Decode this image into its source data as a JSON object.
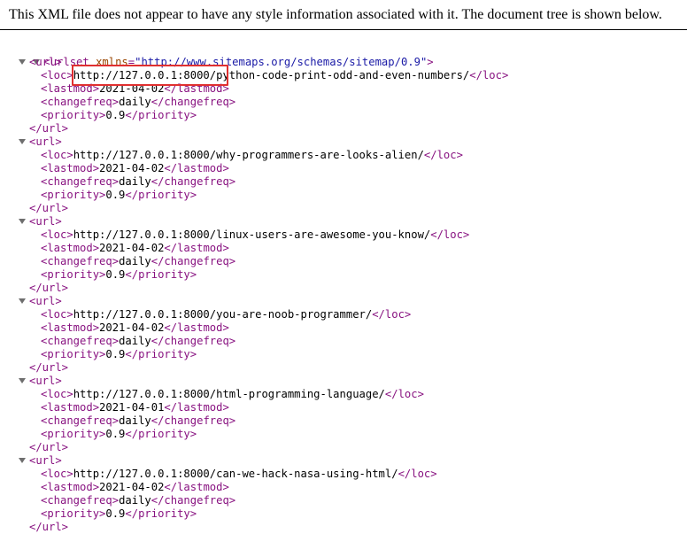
{
  "header": {
    "message": "This XML file does not appear to have any style information associated with it. The document tree is shown below."
  },
  "root": {
    "open_tag": "<urlset",
    "attr_name": "xmlns",
    "attr_eq": "=",
    "attr_value": "\"http://www.sitemaps.org/schemas/sitemap/0.9\"",
    "open_tag_end": ">"
  },
  "tags": {
    "url_open": "<url>",
    "url_close": "</url>",
    "loc_open": "<loc>",
    "loc_close": "</loc>",
    "lastmod_open": "<lastmod>",
    "lastmod_close": "</lastmod>",
    "changefreq_open": "<changefreq>",
    "changefreq_close": "</changefreq>",
    "priority_open": "<priority>",
    "priority_close": "</priority>"
  },
  "urls": [
    {
      "loc": "http://127.0.0.1:8000/python-code-print-odd-and-even-numbers/",
      "lastmod": "2021-04-02",
      "changefreq": "daily",
      "priority": "0.9"
    },
    {
      "loc": "http://127.0.0.1:8000/why-programmers-are-looks-alien/",
      "lastmod": "2021-04-02",
      "changefreq": "daily",
      "priority": "0.9"
    },
    {
      "loc": "http://127.0.0.1:8000/linux-users-are-awesome-you-know/",
      "lastmod": "2021-04-02",
      "changefreq": "daily",
      "priority": "0.9"
    },
    {
      "loc": "http://127.0.0.1:8000/you-are-noob-programmer/",
      "lastmod": "2021-04-02",
      "changefreq": "daily",
      "priority": "0.9"
    },
    {
      "loc": "http://127.0.0.1:8000/html-programming-language/",
      "lastmod": "2021-04-01",
      "changefreq": "daily",
      "priority": "0.9"
    },
    {
      "loc": "http://127.0.0.1:8000/can-we-hack-nasa-using-html/",
      "lastmod": "2021-04-02",
      "changefreq": "daily",
      "priority": "0.9"
    }
  ],
  "colors": {
    "tag": "#881280",
    "attribute_name": "#994500",
    "attribute_value": "#1a1aa6",
    "highlight_box": "#e03030"
  }
}
